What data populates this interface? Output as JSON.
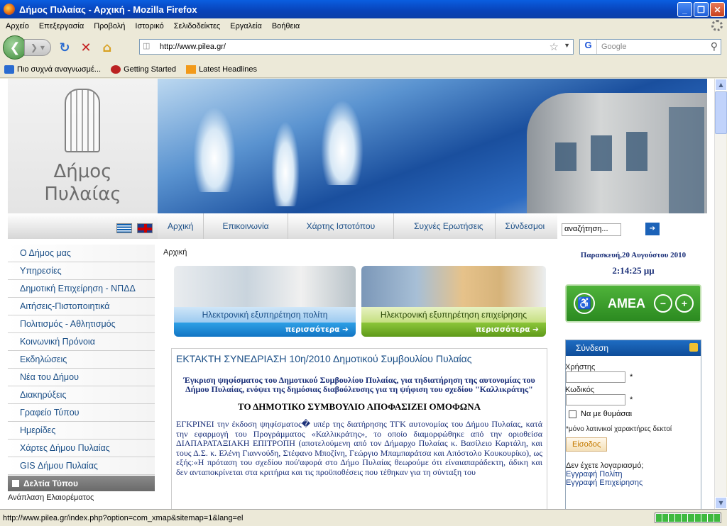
{
  "window": {
    "title": "Δήμος Πυλαίας - Αρχική - Mozilla Firefox"
  },
  "menubar": [
    "Αρχείο",
    "Επεξεργασία",
    "Προβολή",
    "Ιστορικό",
    "Σελιδοδείκτες",
    "Εργαλεία",
    "Βοήθεια"
  ],
  "navbar": {
    "url": "http://www.pilea.gr/",
    "search_placeholder": "Google"
  },
  "bookmarks": [
    "Πιο συχνά αναγνωσμέ...",
    "Getting Started",
    "Latest Headlines"
  ],
  "statusbar": {
    "text": "http://www.pilea.gr/index.php?option=com_xmap&sitemap=1&lang=el"
  },
  "page": {
    "logo": {
      "line1": "Δήμος",
      "line2": "Πυλαίας"
    },
    "topnav": [
      "Αρχική",
      "Επικοινωνία",
      "Χάρτης Ιστοτόπου",
      "Συχνές Ερωτήσεις",
      "Σύνδεσμοι"
    ],
    "search_value": "αναζήτηση...",
    "sidemenu": [
      "Ο Δήμος μας",
      "Υπηρεσίες",
      "Δημοτική Επιχείρηση - ΝΠΔΔ",
      "Αιτήσεις-Πιστοποιητικά",
      "Πολιτισμός - Αθλητισμός",
      "Κοινωνική Πρόνοια",
      "Εκδηλώσεις",
      "Νέα του Δήμου",
      "Διακηρύξεις",
      "Γραφείο Τύπου",
      "Ημερίδες",
      "Χάρτες Δήμου Πυλαίας",
      "GIS Δήμου Πυλαίας"
    ],
    "press_title": "Δελτία Τύπου",
    "press_item": "Ανάπλαση Ελαιορέματος",
    "breadcrumb": "Αρχική",
    "card1": {
      "label": "Ηλεκτρονική εξυπηρέτηση πολίτη",
      "more": "περισσότερα"
    },
    "card2": {
      "label": "Ηλεκτρονική εξυπηρέτηση επιχείρησης",
      "more": "περισσότερα"
    },
    "article": {
      "title": "ΕΚΤΑΚΤΗ ΣΥΝΕΔΡΙΑΣΗ 10η/2010 Δημοτικού Συμβουλίου Πυλαίας",
      "subtitle": "Έγκριση ψηφίσματος του Δημοτικού Συμβουλίου Πυλαίας, για τηδιατήρηση της αυτονομίας του Δήμου Πυλαίας, ενόψει της δημόσιας διαβούλευσης για τη ψήφιση του σχεδίου \"Καλλικράτης\"",
      "caps": "ΤΟ ΔΗΜΟΤΙΚΟ ΣΥΜΒΟΥΛΙΟ ΑΠΟΦΑΣΙΖΕΙ ΟΜΟΦΩΝΑ",
      "body": "ΕΓΚΡΙΝΕΙ την έκδοση ψηφίσματος� υπέρ της διατήρησης ΤΓΚ αυτονομίας του Δήμου Πυλαίας, κατά την εφαρμογή του Προγράμματος «Καλλικράτης», το οποίο διαμορφώθηκε από την οριoθείσα ΔΙΑΠΑΡΑΤΑΞΙΑΚΗ ΕΠΙΤΡΟΠΗ (αποτελούμενη από τον Δήμαρχο Πυλαίας κ. Βασίλειο Καρτάλη, και τους Δ.Σ. κ. Ελένη Γιαννούδη, Στέφανο Μποζίνη, Γεώργιο Μπαμπαράτσα και Απόστολο Κουκουρίκο), ως εξής:«Η πρόταση του σχεδίου πού'αφορά στο Δήμο Πυλαίας θεωρούμε ότι είναιαπαράδεκτη, άδικη και δεν ανταποκρίνεται στα κριτήρια και τις προϋποθέσεις που τέθηκαν για τη σύνταξη του"
    },
    "date": "Παρασκευή,20 Αυγούστου 2010",
    "time": "2:14:25 μμ",
    "amea": "ΑΜΕΑ",
    "login": {
      "title": "Σύνδεση",
      "user_label": "Χρήστης",
      "pass_label": "Κωδικός",
      "remember": "Να με θυμάσαι",
      "note": "*μόνο λατινικοί χαρακτήρες δεκτοί",
      "button": "Είσοδος",
      "no_account": "Δεν έχετε λογαριασμό;",
      "reg_citizen": "Εγγραφή Πολίτη",
      "reg_business": "Εγγραφή Επιχείρησης"
    }
  }
}
